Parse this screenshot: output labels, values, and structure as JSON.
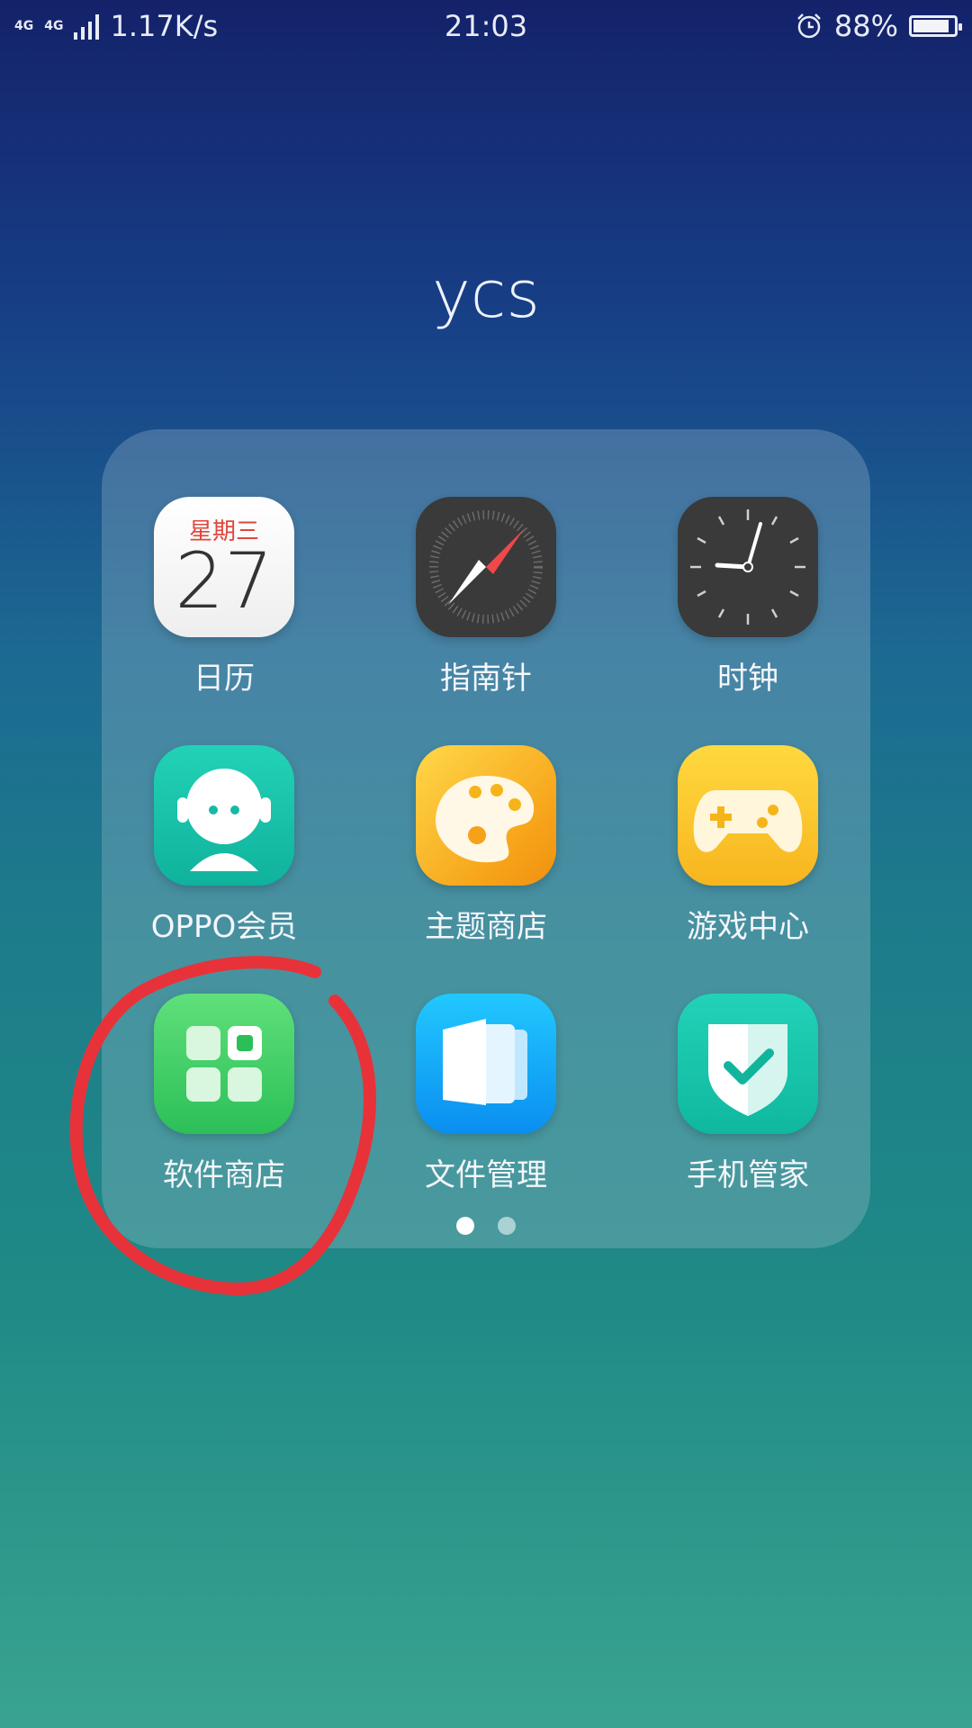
{
  "status_bar": {
    "network_top": "4G",
    "network_top2": "4G",
    "speed": "1.17K/s",
    "time": "21:03",
    "battery": "88%",
    "battery_level": 0.88
  },
  "folder": {
    "title": "ycs",
    "apps": [
      {
        "label": "日历",
        "icon": "calendar-icon",
        "weekday": "星期三",
        "date": "27"
      },
      {
        "label": "指南针",
        "icon": "compass-icon"
      },
      {
        "label": "时钟",
        "icon": "clock-icon"
      },
      {
        "label": "OPPO会员",
        "icon": "oppo-member-icon"
      },
      {
        "label": "主题商店",
        "icon": "theme-store-icon"
      },
      {
        "label": "游戏中心",
        "icon": "game-center-icon"
      },
      {
        "label": "软件商店",
        "icon": "app-store-icon"
      },
      {
        "label": "文件管理",
        "icon": "file-manager-icon"
      },
      {
        "label": "手机管家",
        "icon": "phone-manager-icon"
      }
    ],
    "pages": 2,
    "current_page": 1
  },
  "colors": {
    "annotation": "#e8323a",
    "calendar_weekday": "#e0463c"
  }
}
